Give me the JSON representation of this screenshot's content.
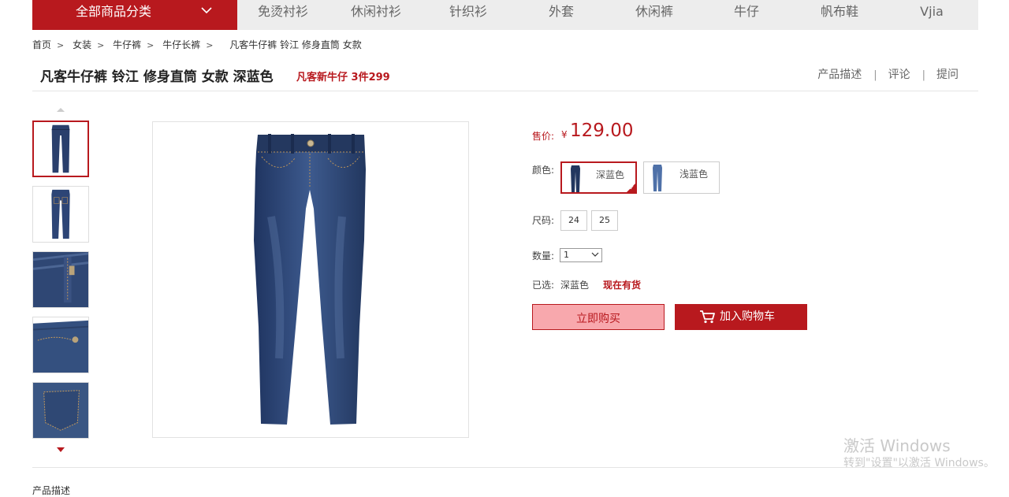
{
  "nav": {
    "all_categories": "全部商品分类",
    "items": [
      "免烫衬衫",
      "休闲衬衫",
      "针织衫",
      "外套",
      "休闲裤",
      "牛仔",
      "帆布鞋",
      "Vjia"
    ]
  },
  "breadcrumb": [
    "首页",
    "女装",
    "牛仔裤",
    "牛仔长裤",
    "凡客牛仔裤 铃江 修身直筒 女款"
  ],
  "product": {
    "title": "凡客牛仔裤 铃江 修身直筒 女款 深蓝色",
    "promo": "凡客新牛仔 3件299",
    "price_label": "售价:",
    "currency": "¥",
    "price": "129.00",
    "color_label": "颜色:",
    "colors": [
      "深蓝色",
      "浅蓝色"
    ],
    "selected_color": "深蓝色",
    "size_label": "尺码:",
    "sizes": [
      "24",
      "25"
    ],
    "qty_label": "数量:",
    "qty_value": "1",
    "selected_label": "已选:",
    "selected_value": "深蓝色",
    "stock": "现在有货",
    "buy_now": "立即购买",
    "add_to_cart": "加入购物车"
  },
  "tabs": [
    "产品描述",
    "评论",
    "提问"
  ],
  "section": {
    "desc_label": "产品描述"
  },
  "watermark": {
    "line1": "激活 Windows",
    "line2": "转到\"设置\"以激活 Windows。"
  },
  "colors": {
    "brand_red": "#b8191e",
    "nav_bg": "#ededed",
    "buy_bg": "#f8a8ad",
    "denim_dark": "#2a3f6c"
  }
}
